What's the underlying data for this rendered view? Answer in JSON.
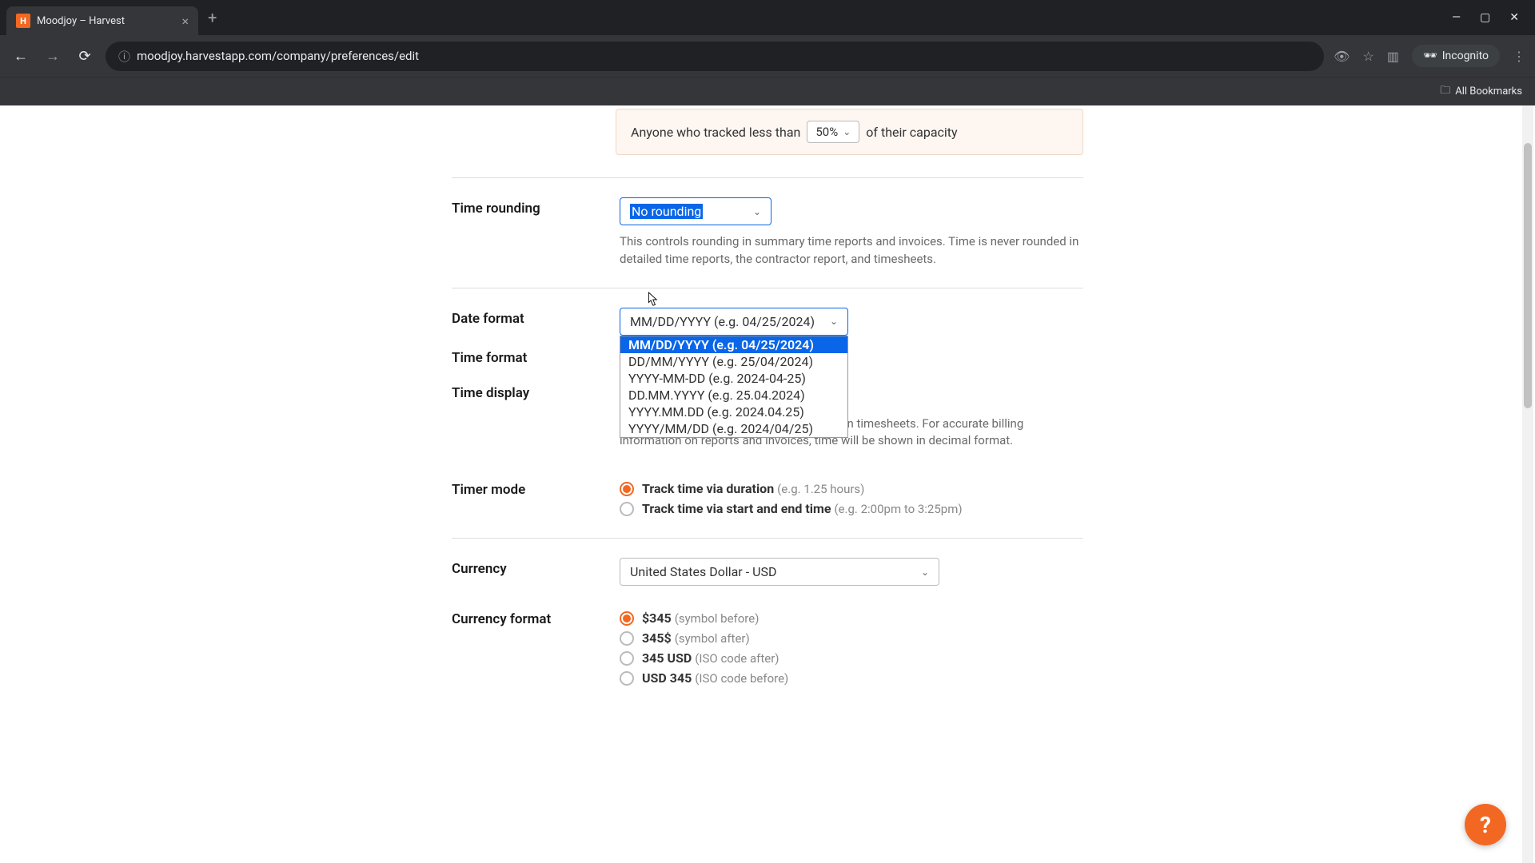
{
  "browser": {
    "tab_title": "Moodjoy – Harvest",
    "url": "moodjoy.harvestapp.com/company/preferences/edit",
    "incognito_label": "Incognito",
    "all_bookmarks": "All Bookmarks"
  },
  "notice": {
    "prefix": "Anyone who tracked less than",
    "percent": "50%",
    "suffix": "of their capacity"
  },
  "time_rounding": {
    "label": "Time rounding",
    "value": "No rounding",
    "helper": "This controls rounding in summary time reports and invoices. Time is never rounded in detailed time reports, the contractor report, and timesheets."
  },
  "date_format": {
    "label": "Date format",
    "value": "MM/DD/YYYY (e.g. 04/25/2024)",
    "options": [
      "MM/DD/YYYY (e.g. 04/25/2024)",
      "DD/MM/YYYY (e.g. 25/04/2024)",
      "YYYY-MM-DD (e.g. 2024-04-25)",
      "DD.MM.YYYY (e.g. 25.04.2024)",
      "YYYY.MM.DD (e.g. 2024.04.25)",
      "YYYY/MM/DD (e.g. 2024/04/25)"
    ]
  },
  "time_format": {
    "label": "Time format"
  },
  "time_display": {
    "label": "Time display",
    "helper": "Note that \"HH:MM\" format will only show on timesheets. For accurate billing information on reports and invoices, time will be shown in decimal format."
  },
  "timer_mode": {
    "label": "Timer mode",
    "opt1_main": "Track time via duration",
    "opt1_hint": "(e.g. 1.25 hours)",
    "opt2_main": "Track time via start and end time",
    "opt2_hint": "(e.g. 2:00pm to 3:25pm)"
  },
  "currency": {
    "label": "Currency",
    "value": "United States Dollar - USD"
  },
  "currency_format": {
    "label": "Currency format",
    "opts": [
      {
        "main": "$345",
        "hint": "(symbol before)"
      },
      {
        "main": "345$",
        "hint": "(symbol after)"
      },
      {
        "main": "345 USD",
        "hint": "(ISO code after)"
      },
      {
        "main": "USD 345",
        "hint": "(ISO code before)"
      }
    ]
  },
  "help_fab": "?"
}
